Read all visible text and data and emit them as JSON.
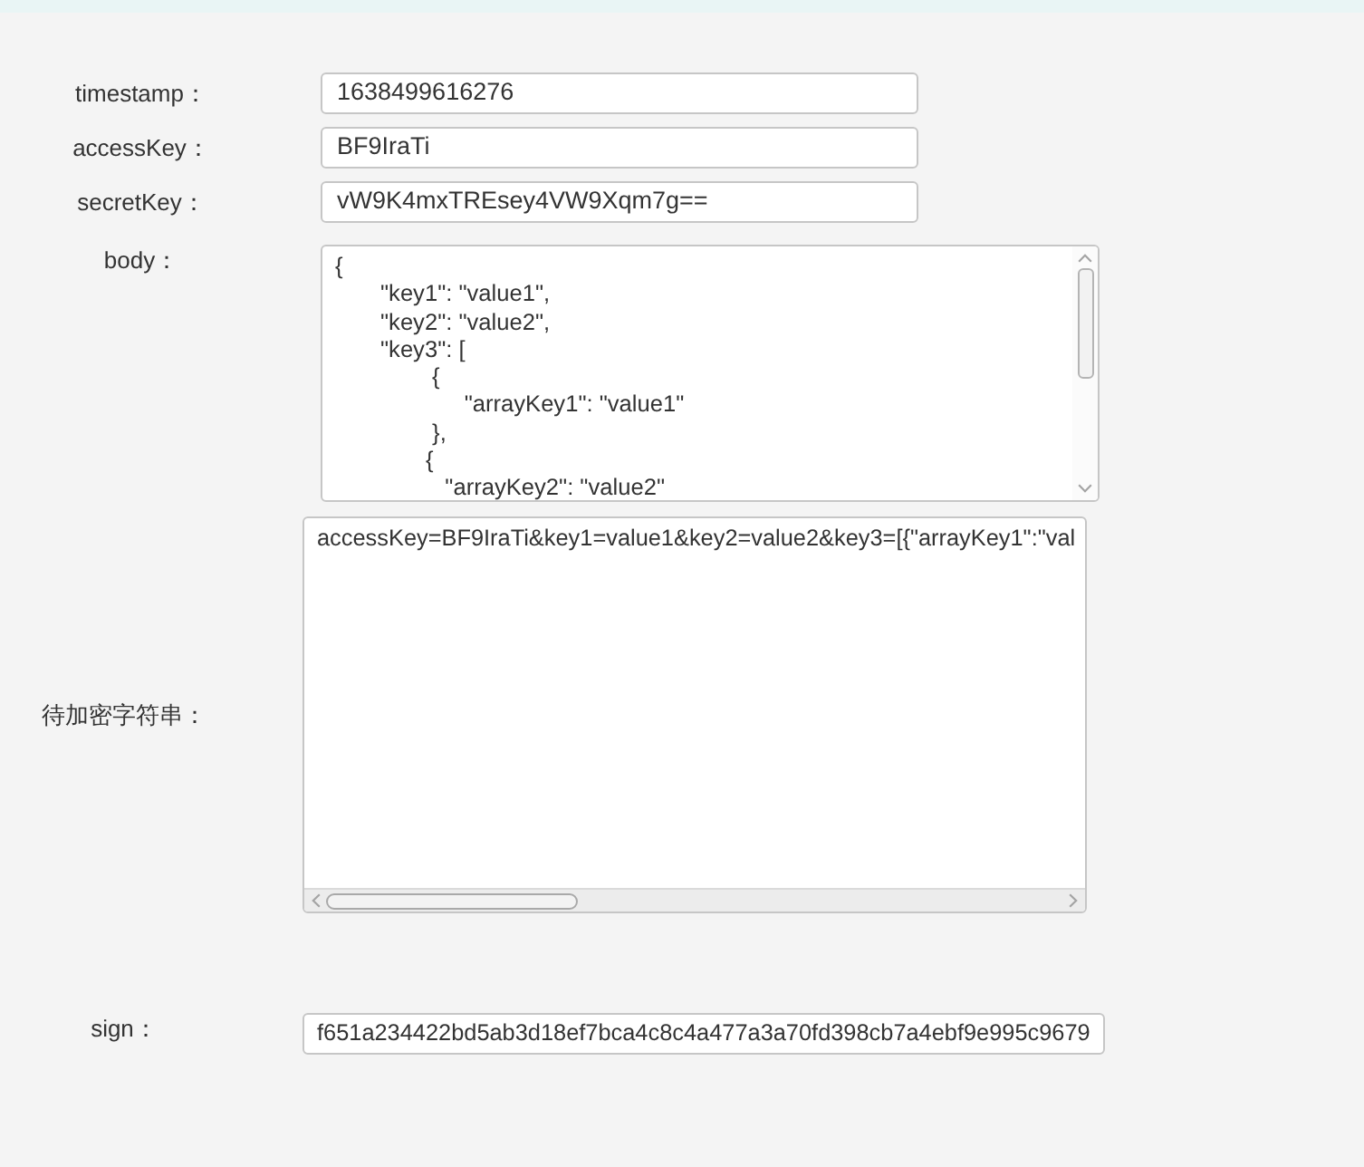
{
  "fields": [
    {
      "label": "timestamp：",
      "value": "1638499616276"
    },
    {
      "label": "accessKey：",
      "value": "BF9IraTi"
    },
    {
      "label": "secretKey：",
      "value": "vW9K4mxTREsey4VW9Xqm7g=="
    }
  ],
  "body": {
    "label": "body：",
    "lines": [
      "{",
      "\t\"key1\": \"value1\",",
      "\t\"key2\": \"value2\",",
      "\t\"key3\": [",
      "\t\t {",
      "\t\t      \"arrayKey1\": \"value1\"",
      "\t\t },",
      "\t\t{",
      "\t\t   \"arrayKey2\": \"value2\""
    ]
  },
  "string_to_sign": {
    "label": "待加密字符串：",
    "value": "accessKey=BF9IraTi&key1=value1&key2=value2&key3=[{\"arrayKey1\":\"val"
  },
  "sign": {
    "label": "sign：",
    "value": "f651a234422bd5ab3d18ef7bca4c8c4a477a3a70fd398cb7a4ebf9e995c9679"
  }
}
